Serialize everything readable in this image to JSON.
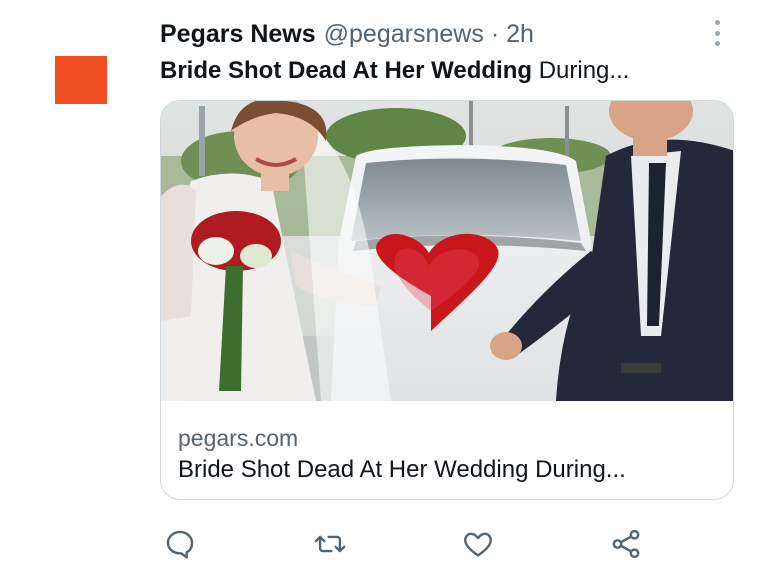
{
  "tweet": {
    "author_name": "Pegars News",
    "author_handle": "@pegarsnews",
    "separator": "·",
    "time": "2h",
    "text_bold": "Bride Shot Dead At Her Wedding",
    "text_rest": " During...",
    "avatar_color": "#f04e23"
  },
  "card": {
    "domain": "pegars.com",
    "title": "Bride Shot Dead At Her Wedding During..."
  },
  "icons": {
    "more": "more-icon",
    "reply": "reply-icon",
    "retweet": "retweet-icon",
    "like": "like-icon",
    "share": "share-icon"
  },
  "colors": {
    "secondary_text": "#536471",
    "border": "#cfd9de",
    "icon": "#536471"
  }
}
